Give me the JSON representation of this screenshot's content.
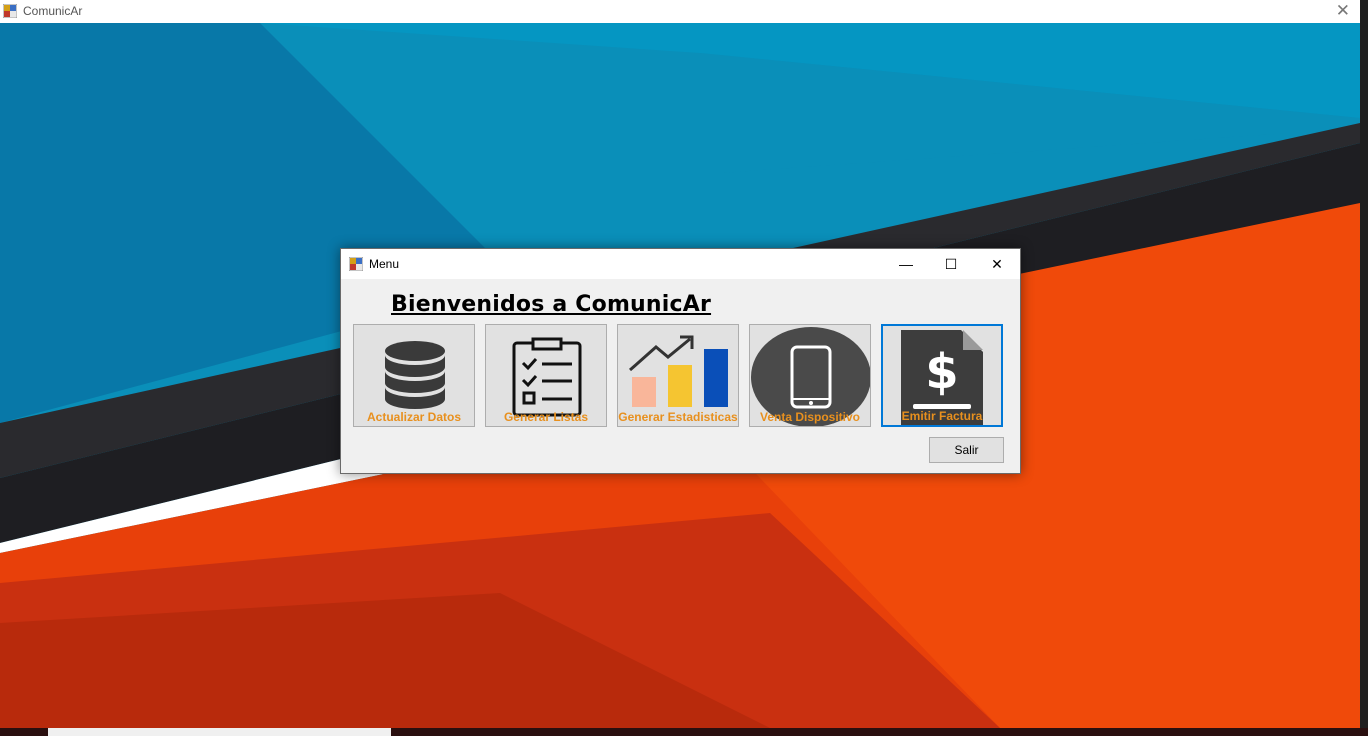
{
  "main_window": {
    "title": "ComunicAr",
    "close_glyph": "✕"
  },
  "dialog": {
    "title": "Menu",
    "minimize_glyph": "—",
    "maximize_glyph": "☐",
    "close_glyph": "✕",
    "heading": "Bienvenidos a ComunicAr",
    "tiles": [
      {
        "label": "Actualizar Datos",
        "icon": "database-icon"
      },
      {
        "label": "Generar Listas",
        "icon": "clipboard-checklist-icon"
      },
      {
        "label": "Generar Estadisticas",
        "icon": "bar-chart-trend-icon"
      },
      {
        "label": "Venta Dispositivo",
        "icon": "smartphone-icon"
      },
      {
        "label": "Emitir Factura",
        "icon": "dollar-document-icon"
      }
    ],
    "exit_button": "Salir"
  },
  "colors": {
    "label_orange": "#e8901e",
    "selection_blue": "#0078d7",
    "wallpaper_blue": "#0a8fb9",
    "wallpaper_orange": "#f04a0a"
  }
}
